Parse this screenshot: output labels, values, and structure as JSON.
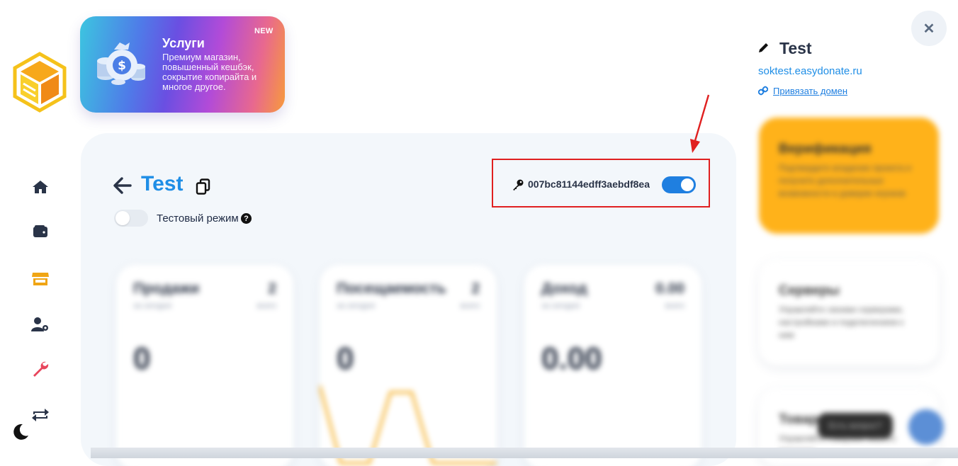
{
  "sidebar": {
    "logo": "easydonate-logo",
    "items": [
      {
        "icon": "home-icon",
        "color": "#2a3448"
      },
      {
        "icon": "wallet-icon",
        "color": "#2a3448"
      },
      {
        "icon": "store-icon",
        "color": "#f0a514"
      },
      {
        "icon": "user-gear-icon",
        "color": "#2a3448"
      },
      {
        "icon": "wrench-icon",
        "color": "#e8455c"
      },
      {
        "icon": "repeat-icon",
        "color": "#2a3448"
      }
    ],
    "theme_icon": "moon-icon"
  },
  "promo": {
    "title": "Услуги",
    "description": "Премиум магазин, повышенный кешбэк, сокрытие копирайта и многое другое.",
    "badge": "NEW"
  },
  "shop": {
    "title": "Test",
    "test_mode_label": "Тестовый режим",
    "test_mode_enabled": false,
    "api_key": "007bc81144edff3aebdf8ea",
    "key_enabled": true
  },
  "stats": [
    {
      "title": "Продажи",
      "count": "2",
      "subtitle": "за сегодня",
      "subtitle_right": "всего",
      "value": "0"
    },
    {
      "title": "Посещаемость",
      "count": "2",
      "subtitle": "за сегодня",
      "subtitle_right": "всего",
      "value": "0"
    },
    {
      "title": "Доход",
      "count": "0.00",
      "subtitle": "за сегодня",
      "subtitle_right": "всего",
      "value": "0.00"
    }
  ],
  "right_panel": {
    "title": "Test",
    "domain": "soktest.easydonate.ru",
    "link_label": "Привязать домен",
    "cards": [
      {
        "title": "Верификация",
        "description": "Подтвердите владение проекта и получите дополнительные возможности и доверие игроков",
        "color": "#ffb21a"
      },
      {
        "title": "Серверы",
        "description": "Управляйте своими серверами, настройками и подключением к ним",
        "color": "#ffffff"
      },
      {
        "title": "Товары",
        "description": "Управляйте товарами вашего магазина",
        "color": "#ffffff"
      }
    ],
    "chat_tooltip": "Есть вопрос?"
  },
  "accent": "#1f8ee6",
  "annotation_color": "#e02020"
}
